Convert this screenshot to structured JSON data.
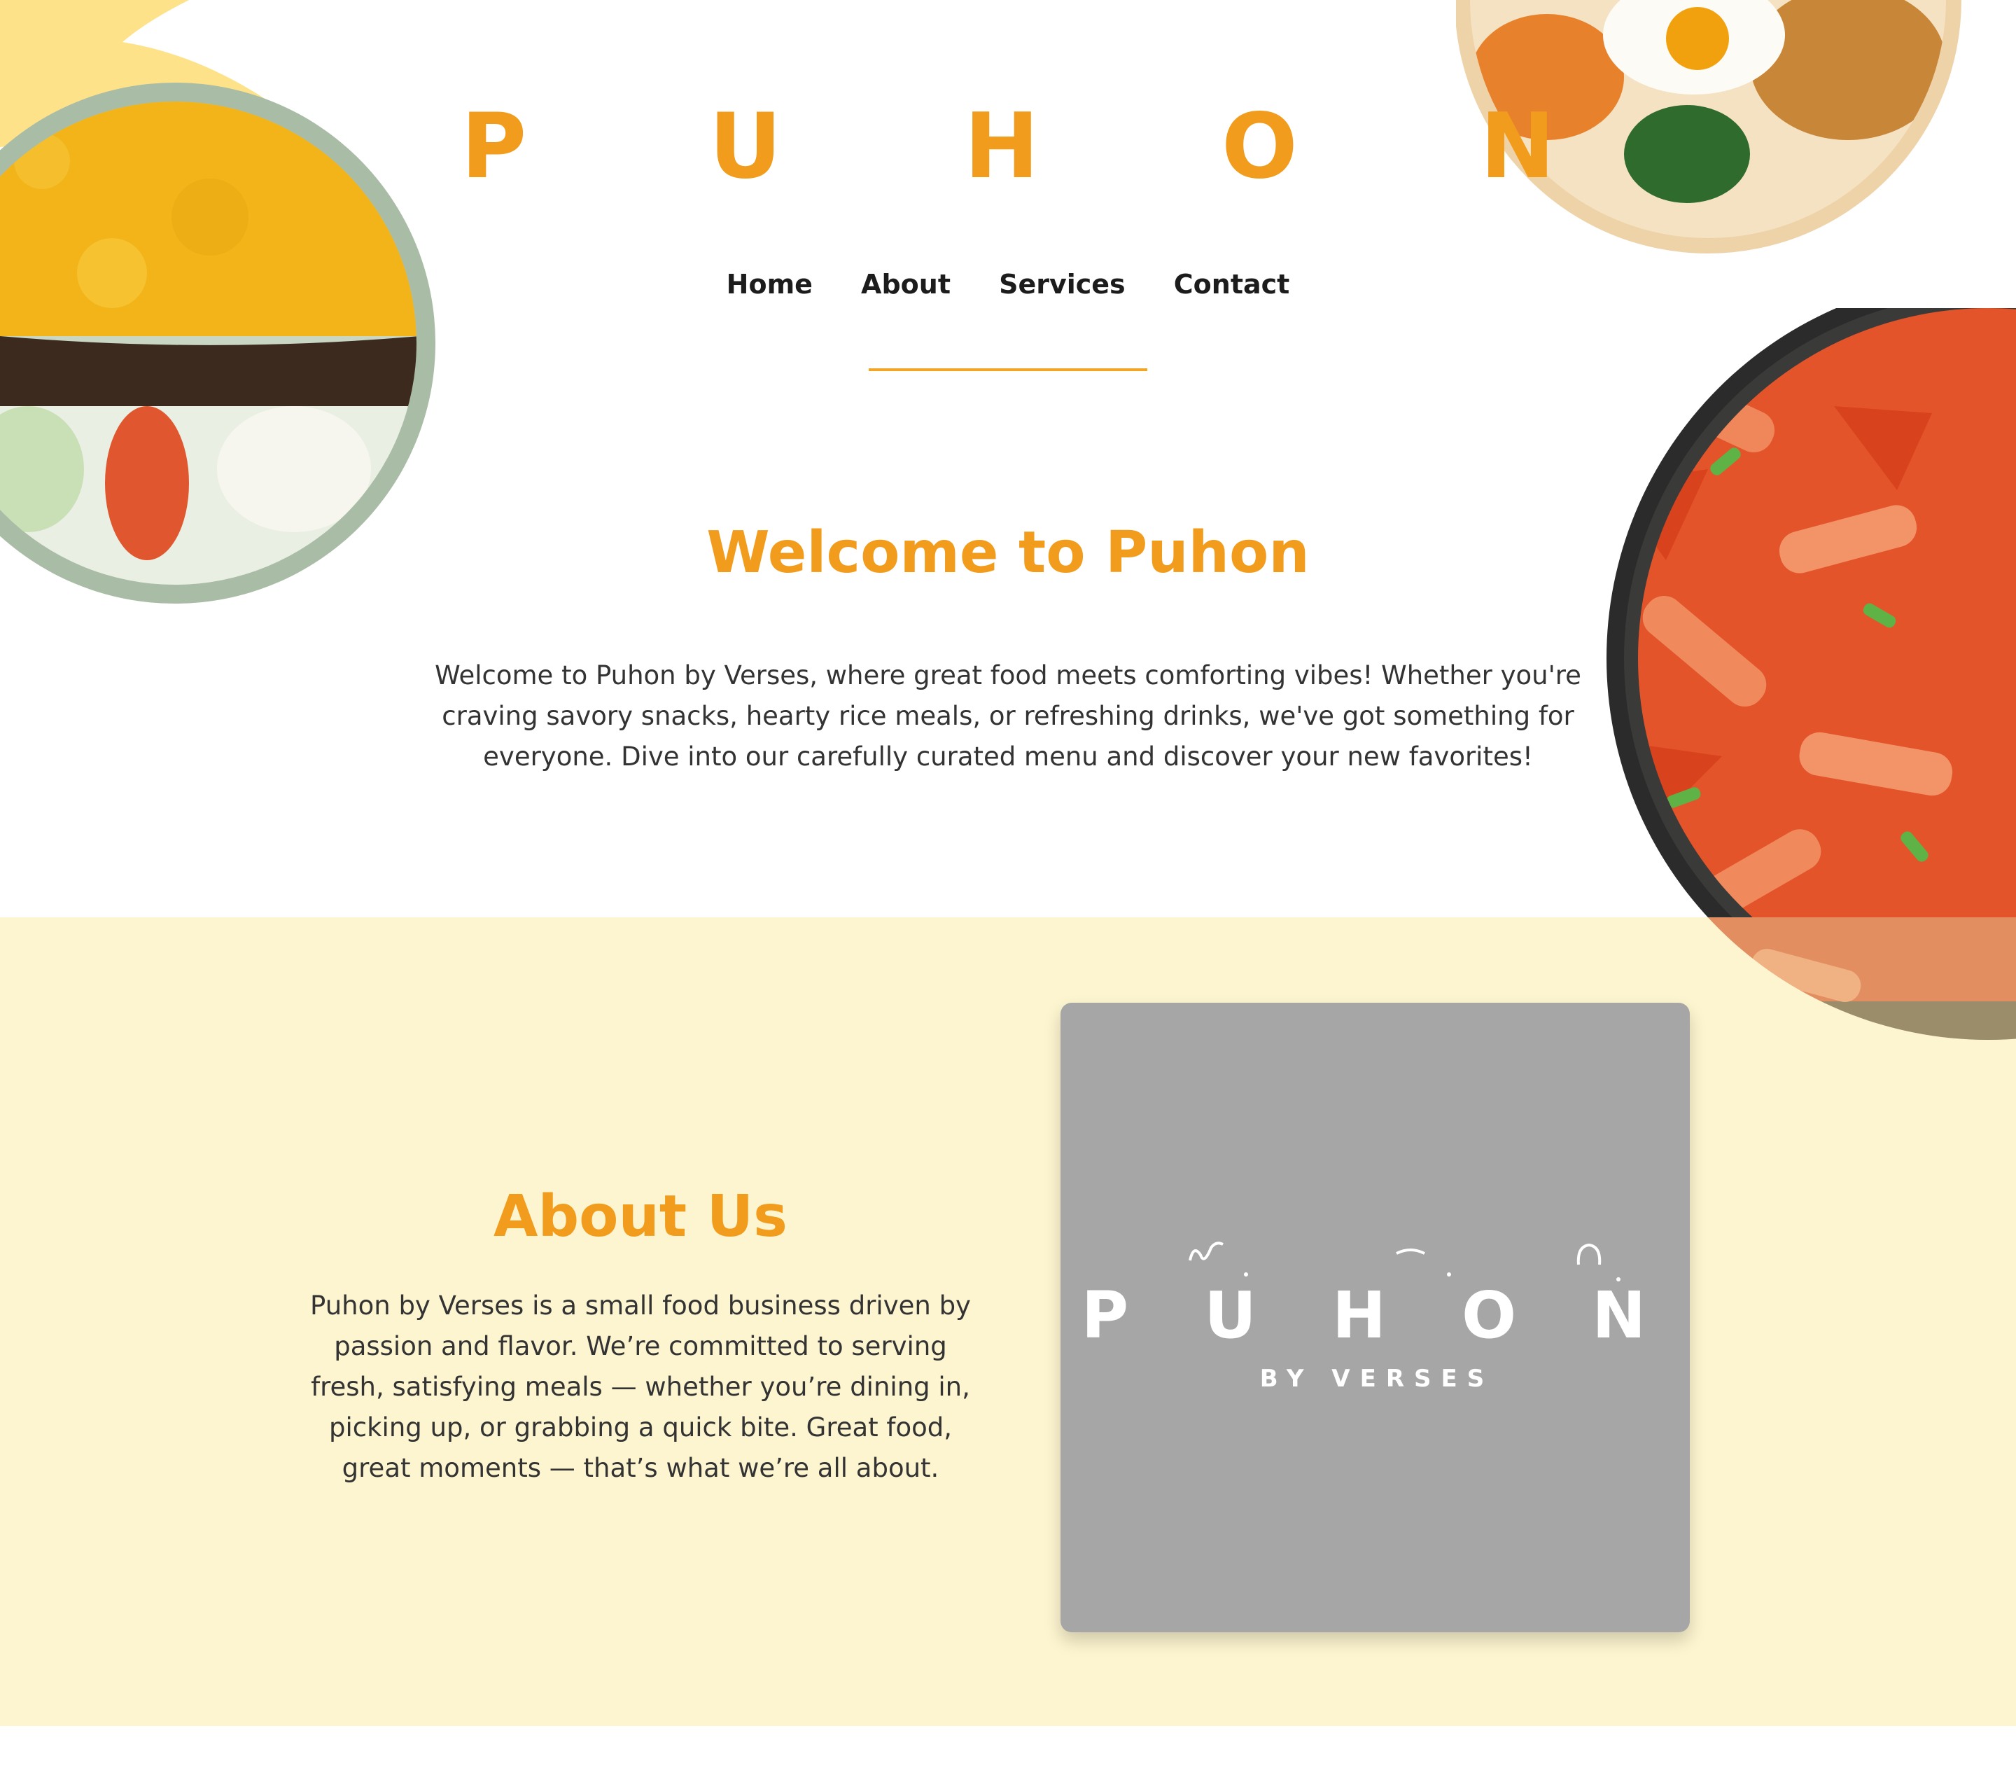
{
  "brand": {
    "title": "P U H O N"
  },
  "nav": {
    "items": [
      {
        "label": "Home"
      },
      {
        "label": "About"
      },
      {
        "label": "Services"
      },
      {
        "label": "Contact"
      }
    ]
  },
  "welcome": {
    "title": "Welcome to Puhon",
    "text": "Welcome to Puhon by Verses, where great food meets comforting vibes! Whether you're craving savory snacks, hearty rice meals, or refreshing drinks, we've got something for everyone. Dive into our carefully curated menu and discover your new favorites!"
  },
  "about": {
    "title": "About Us",
    "text": "Puhon by Verses is a small food business driven by passion and flavor. We’re committed to serving fresh, satisfying meals — whether you’re dining in, picking up, or grabbing a quick bite. Great food, great moments — that’s what we’re all about."
  },
  "logo": {
    "wordmark": "P U H O N",
    "tagline": "BY VERSES"
  },
  "colors": {
    "accent": "#f19c1c",
    "about_background": "#fdf5cf",
    "logo_card": "#a6a6a6"
  },
  "images": {
    "rice_bowl": "rice-bowl-image",
    "bibimbap": "bibimbap-image",
    "tteokbokki": "tteokbokki-image"
  }
}
